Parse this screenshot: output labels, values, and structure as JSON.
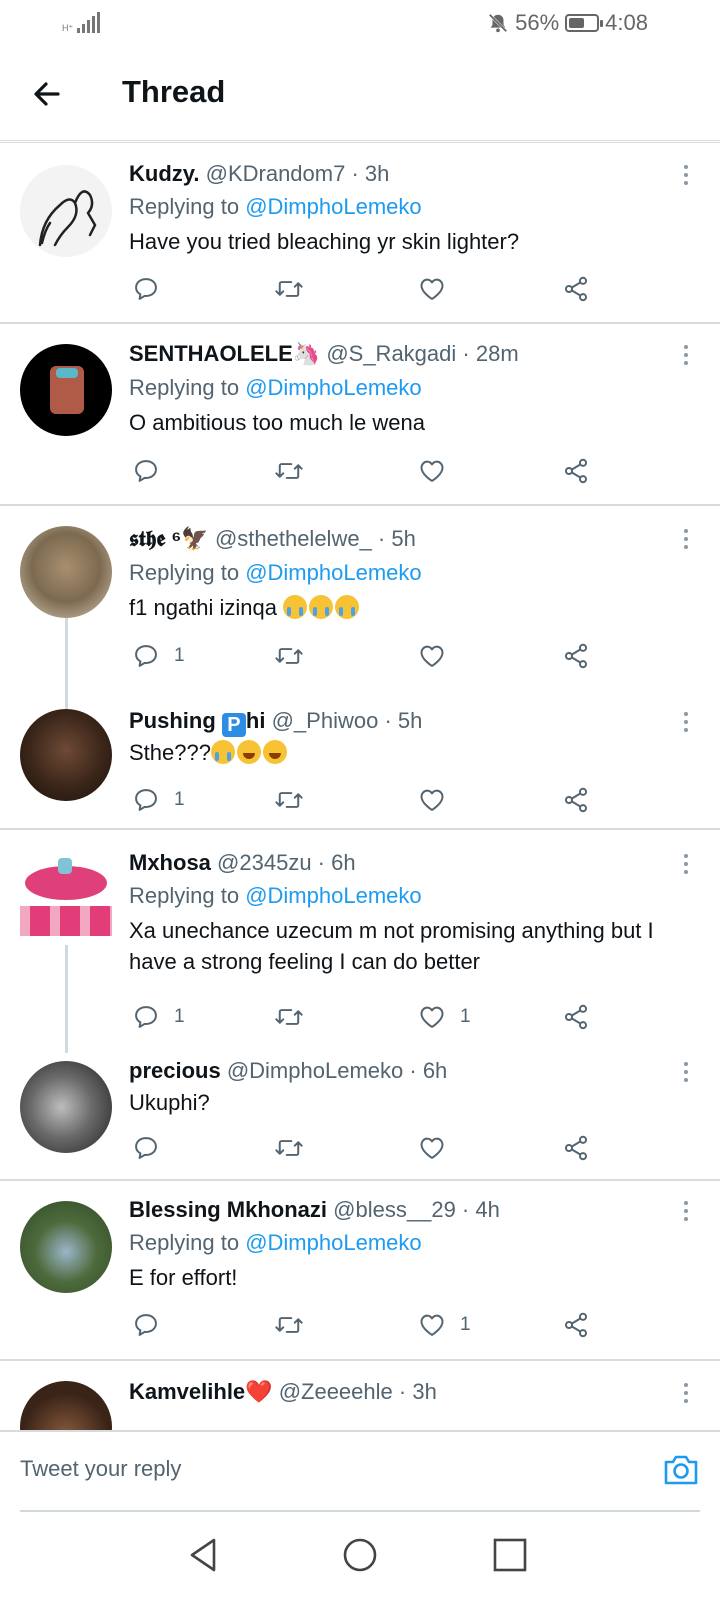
{
  "status": {
    "network": "H⁺",
    "battery": "56%",
    "battery_level": 0.56,
    "time": "4:08"
  },
  "header": {
    "title": "Thread"
  },
  "tweets": [
    {
      "name": "Kudzy.",
      "handle": "@KDrandom7",
      "time": "3h",
      "replying_prefix": "Replying to",
      "replying_to": "@DimphoLemeko",
      "text": "Have you tried bleaching yr skin lighter?",
      "replies": "",
      "likes": ""
    },
    {
      "name": "SENTHAOLELE🦄",
      "handle": "@S_Rakgadi",
      "time": "28m",
      "replying_prefix": "Replying to",
      "replying_to": "@DimphoLemeko",
      "text": "O ambitious too much le wena",
      "replies": "",
      "likes": ""
    },
    {
      "name": "𝖘𝖙𝖍𝖊 ⁶🦅",
      "handle": "@sthethelelwe_",
      "time": "5h",
      "replying_prefix": "Replying to",
      "replying_to": "@DimphoLemeko",
      "text": "f1 ngathi izinqa",
      "replies": "1",
      "likes": ""
    },
    {
      "name_a": "Pushing",
      "name_badge": "P",
      "name_b": "hi",
      "handle": "@_Phiwoo",
      "time": "5h",
      "text": "Sthe???",
      "replies": "1",
      "likes": ""
    },
    {
      "name": "Mxhosa",
      "handle": "@2345zu",
      "time": "6h",
      "replying_prefix": "Replying to",
      "replying_to": "@DimphoLemeko",
      "text": "Xa unechance uzecum m not promising anything but I have a strong feeling I can do better",
      "replies": "1",
      "likes": "1"
    },
    {
      "name": "precious",
      "handle": "@DimphoLemeko",
      "time": "6h",
      "text": "Ukuphi?",
      "replies": "",
      "likes": ""
    },
    {
      "name": "Blessing Mkhonazi",
      "handle": "@bless__29",
      "time": "4h",
      "replying_prefix": "Replying to",
      "replying_to": "@DimphoLemeko",
      "text": "E for effort!",
      "replies": "",
      "likes": "1"
    },
    {
      "name": "Kamvelihle❤️",
      "handle": "@Zeeeehle",
      "time": "3h"
    }
  ],
  "reply_box": {
    "placeholder": "Tweet your reply"
  },
  "icons": {
    "back": "arrow-left-icon",
    "more": "more-vertical-icon",
    "reply": "comment-icon",
    "retweet": "retweet-icon",
    "like": "heart-icon",
    "share": "share-icon",
    "camera": "camera-icon",
    "nav_back": "triangle-back-icon",
    "nav_home": "circle-home-icon",
    "nav_recents": "square-recents-icon"
  },
  "colors": {
    "accent": "#1d9bf0",
    "text": "#0f1419",
    "secondary": "#536471",
    "divider": "#d6dbe0"
  }
}
